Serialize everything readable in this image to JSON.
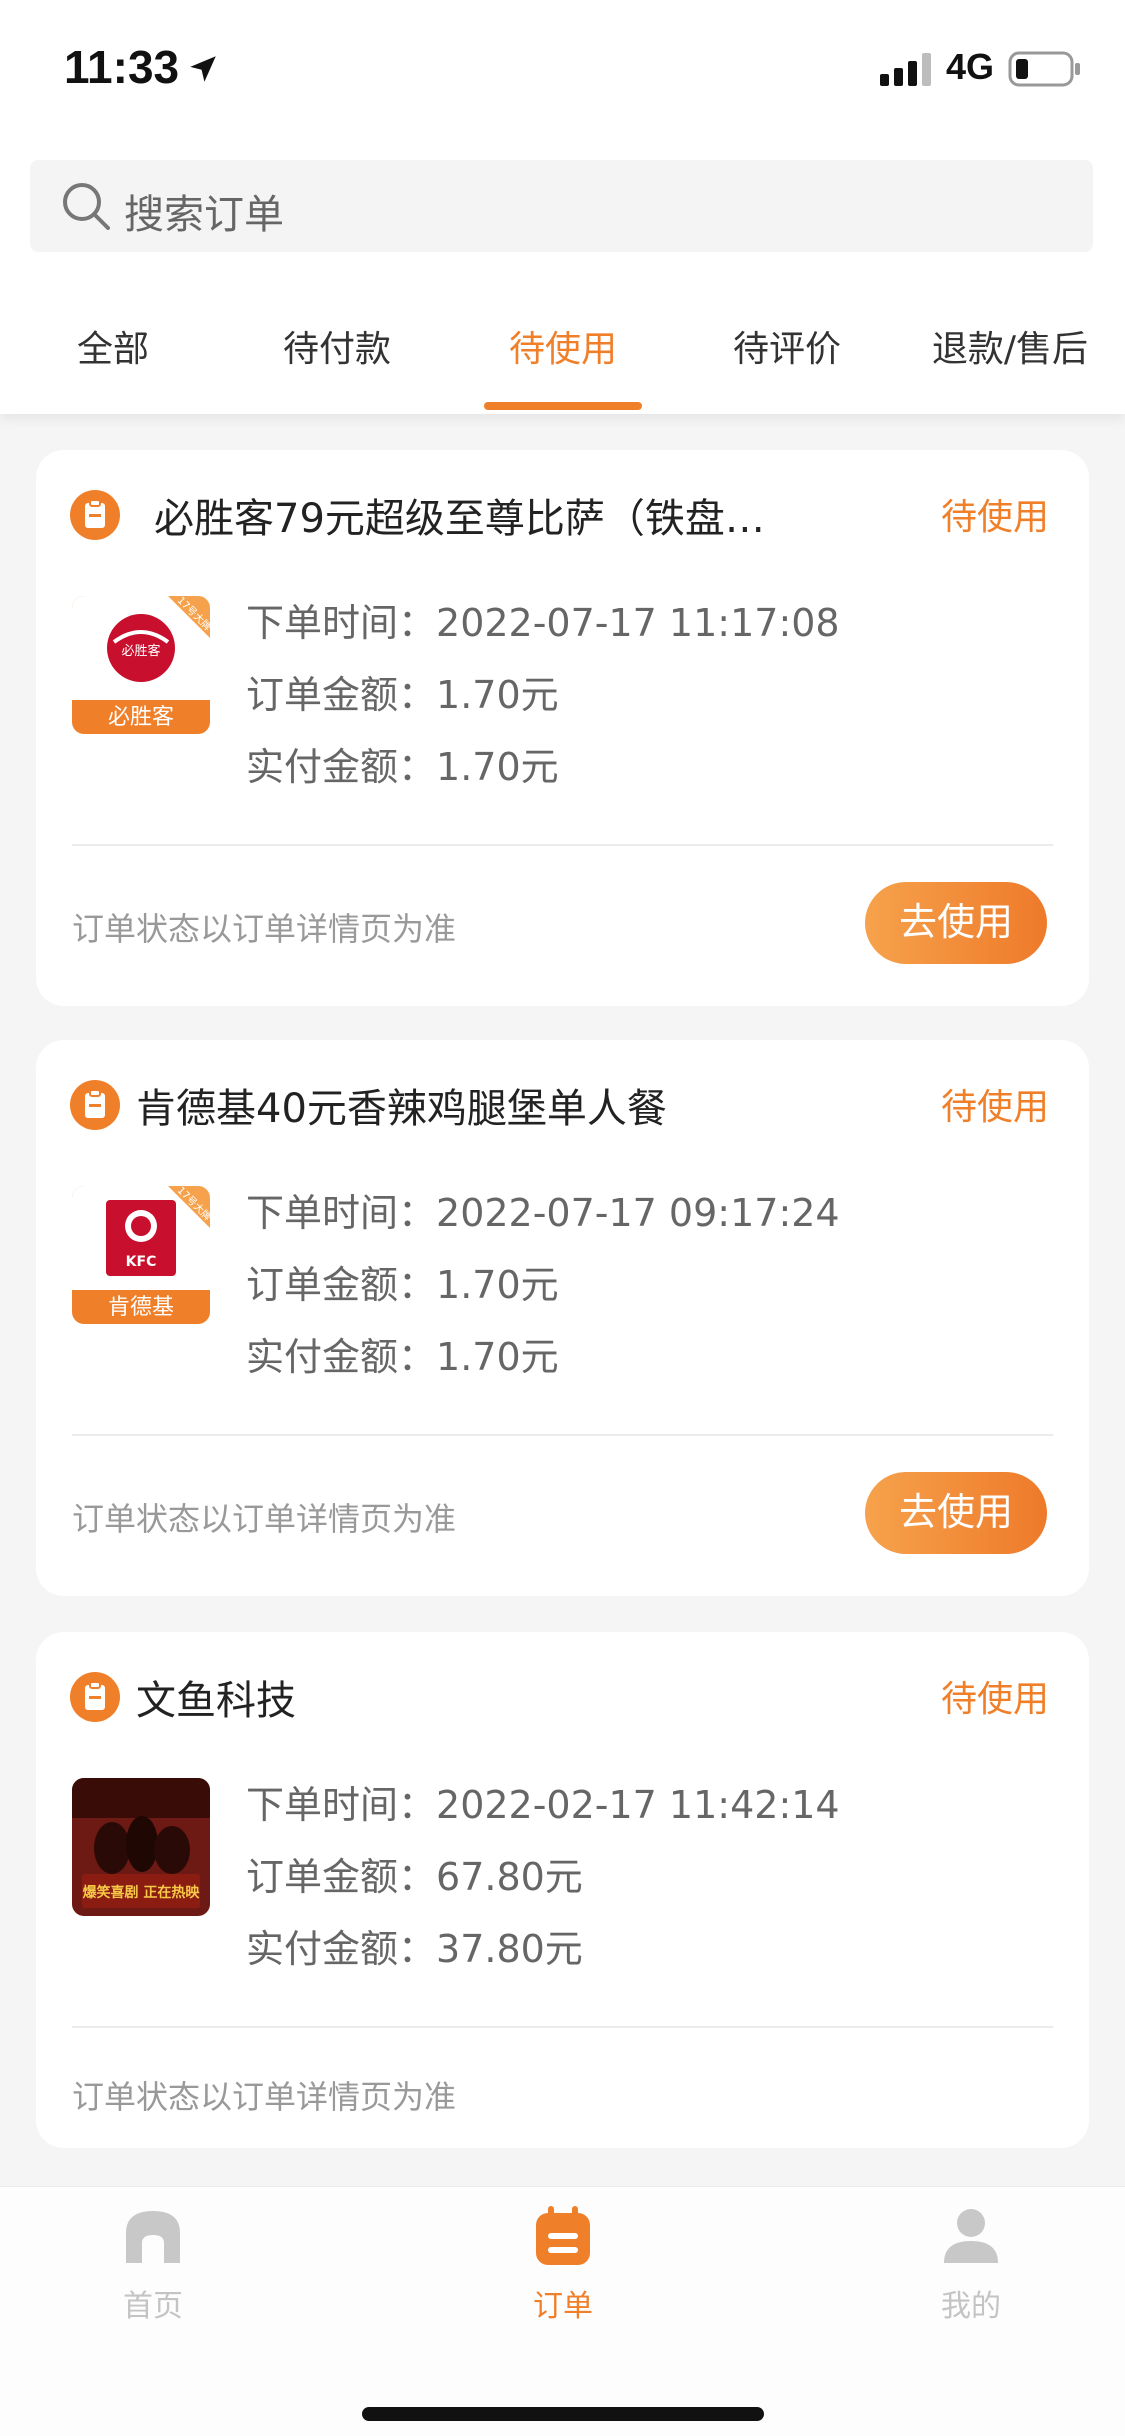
{
  "status_bar": {
    "time": "11:33",
    "network": "4G",
    "location_icon": "location-arrow-icon",
    "signal_icon": "signal-bars-icon",
    "battery_icon": "battery-low-icon"
  },
  "search": {
    "placeholder": "搜索订单",
    "icon": "search-icon"
  },
  "tabs": [
    {
      "label": "全部",
      "active": false
    },
    {
      "label": "待付款",
      "active": false
    },
    {
      "label": "待使用",
      "active": true
    },
    {
      "label": "待评价",
      "active": false
    },
    {
      "label": "退款/售后",
      "active": false
    }
  ],
  "labels": {
    "order_time": "下单时间：",
    "order_amount": "订单金额：",
    "paid_amount": "实付金额："
  },
  "orders": [
    {
      "shop_name": "必胜客79元超级至尊比萨（铁盘…",
      "status": "待使用",
      "thumb_text": "必胜客",
      "thumb_logo_text": "必胜客",
      "thumb_corner_text": "17号大牌",
      "order_time": "2022-07-17 11:17:08",
      "order_amount": "1.70元",
      "paid_amount": "1.70元",
      "note": "订单状态以订单详情页为准",
      "action": "去使用"
    },
    {
      "shop_name": "肯德基40元香辣鸡腿堡单人餐",
      "status": "待使用",
      "thumb_text": "肯德基",
      "thumb_logo_text": "KFC",
      "thumb_corner_text": "17号大牌",
      "order_time": "2022-07-17 09:17:24",
      "order_amount": "1.70元",
      "paid_amount": "1.70元",
      "note": "订单状态以订单详情页为准",
      "action": "去使用"
    },
    {
      "shop_name": "文鱼科技",
      "status": "待使用",
      "thumb_text": "爆笑喜剧 正在热映",
      "order_time": "2022-02-17 11:42:14",
      "order_amount": "67.80元",
      "paid_amount": "37.80元",
      "note": "订单状态以订单详情页为准"
    }
  ],
  "bottom_nav": [
    {
      "label": "首页",
      "icon": "home-icon",
      "active": false
    },
    {
      "label": "订单",
      "icon": "orders-icon",
      "active": true
    },
    {
      "label": "我的",
      "icon": "profile-icon",
      "active": false
    }
  ],
  "colors": {
    "accent": "#f07f2a",
    "button_gradient_start": "#f6a24c",
    "button_gradient_end": "#ee7a2a",
    "background": "#f5f5f5",
    "card": "#ffffff",
    "inactive_nav": "#c4c4c4"
  }
}
